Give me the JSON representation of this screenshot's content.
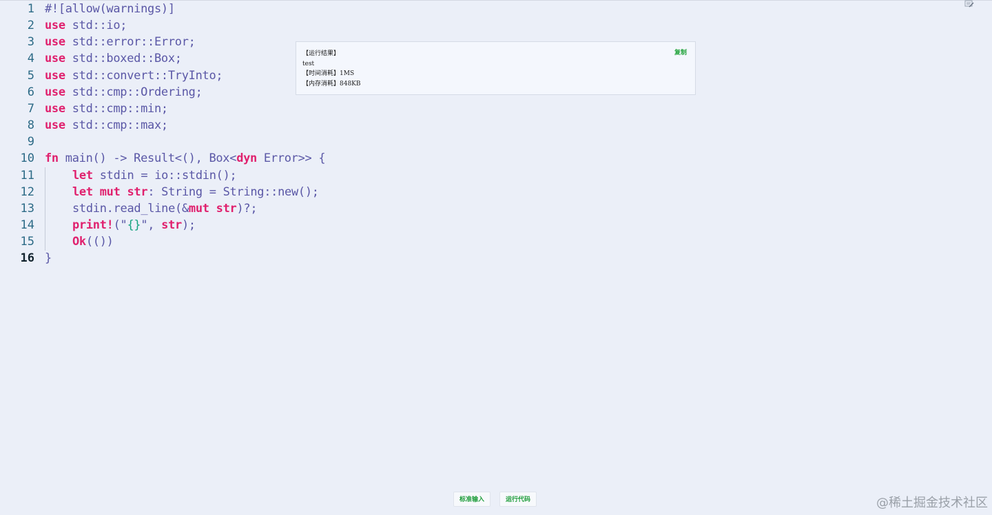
{
  "editor": {
    "line_numbers": [
      "1",
      "2",
      "3",
      "4",
      "5",
      "6",
      "7",
      "8",
      "9",
      "10",
      "11",
      "12",
      "13",
      "14",
      "15",
      "16"
    ],
    "lines": [
      {
        "segments": [
          {
            "t": "#![allow(warnings)]",
            "c": "plain"
          }
        ]
      },
      {
        "segments": [
          {
            "t": "use",
            "c": "kw"
          },
          {
            "t": " std::io;",
            "c": "plain"
          }
        ]
      },
      {
        "segments": [
          {
            "t": "use",
            "c": "kw"
          },
          {
            "t": " std::error::Error;",
            "c": "plain"
          }
        ]
      },
      {
        "segments": [
          {
            "t": "use",
            "c": "kw"
          },
          {
            "t": " std::boxed::Box;",
            "c": "plain"
          }
        ]
      },
      {
        "segments": [
          {
            "t": "use",
            "c": "kw"
          },
          {
            "t": " std::convert::TryInto;",
            "c": "plain"
          }
        ]
      },
      {
        "segments": [
          {
            "t": "use",
            "c": "kw"
          },
          {
            "t": " std::cmp::Ordering;",
            "c": "plain"
          }
        ]
      },
      {
        "segments": [
          {
            "t": "use",
            "c": "kw"
          },
          {
            "t": " std::cmp::min;",
            "c": "plain"
          }
        ]
      },
      {
        "segments": [
          {
            "t": "use",
            "c": "kw"
          },
          {
            "t": " std::cmp::max;",
            "c": "plain"
          }
        ]
      },
      {
        "segments": [
          {
            "t": "",
            "c": "plain"
          }
        ]
      },
      {
        "segments": [
          {
            "t": "fn",
            "c": "kw"
          },
          {
            "t": " main() -> Result<(), Box<",
            "c": "plain"
          },
          {
            "t": "dyn",
            "c": "kw"
          },
          {
            "t": " Error>> {",
            "c": "plain"
          }
        ]
      },
      {
        "indent": true,
        "segments": [
          {
            "t": "let",
            "c": "kw"
          },
          {
            "t": " stdin = io::stdin();",
            "c": "plain"
          }
        ]
      },
      {
        "indent": true,
        "segments": [
          {
            "t": "let",
            "c": "kw"
          },
          {
            "t": " ",
            "c": "plain"
          },
          {
            "t": "mut",
            "c": "kw"
          },
          {
            "t": " ",
            "c": "plain"
          },
          {
            "t": "str",
            "c": "kw"
          },
          {
            "t": ": String = String::new();",
            "c": "plain"
          }
        ]
      },
      {
        "indent": true,
        "segments": [
          {
            "t": "stdin.read_line(&",
            "c": "plain"
          },
          {
            "t": "mut",
            "c": "kw"
          },
          {
            "t": " ",
            "c": "plain"
          },
          {
            "t": "str",
            "c": "kw"
          },
          {
            "t": ")?;",
            "c": "plain"
          }
        ]
      },
      {
        "indent": true,
        "segments": [
          {
            "t": "print!",
            "c": "kw"
          },
          {
            "t": "(\"",
            "c": "plain"
          },
          {
            "t": "{}",
            "c": "str"
          },
          {
            "t": "\", ",
            "c": "plain"
          },
          {
            "t": "str",
            "c": "kw"
          },
          {
            "t": ");",
            "c": "plain"
          }
        ]
      },
      {
        "indent": true,
        "segments": [
          {
            "t": "Ok",
            "c": "kw"
          },
          {
            "t": "(())",
            "c": "plain"
          }
        ]
      },
      {
        "segments": [
          {
            "t": "}",
            "c": "plain"
          }
        ]
      }
    ],
    "active_line": "16"
  },
  "result": {
    "lines": [
      "【运行结果】",
      "test",
      "【时间消耗】1MS",
      "【内存消耗】848KB"
    ],
    "copy_label": "复制"
  },
  "toolbar": {
    "stdin_label": "标准输入",
    "run_label": "运行代码"
  },
  "watermark": "@稀土掘金技术社区",
  "colors": {
    "background": "#ebeff8",
    "keyword": "#e0216e",
    "identifier": "#5a57a6",
    "string": "#14a37f",
    "line_number": "#2c6a86",
    "button_text": "#1f9d3b"
  }
}
